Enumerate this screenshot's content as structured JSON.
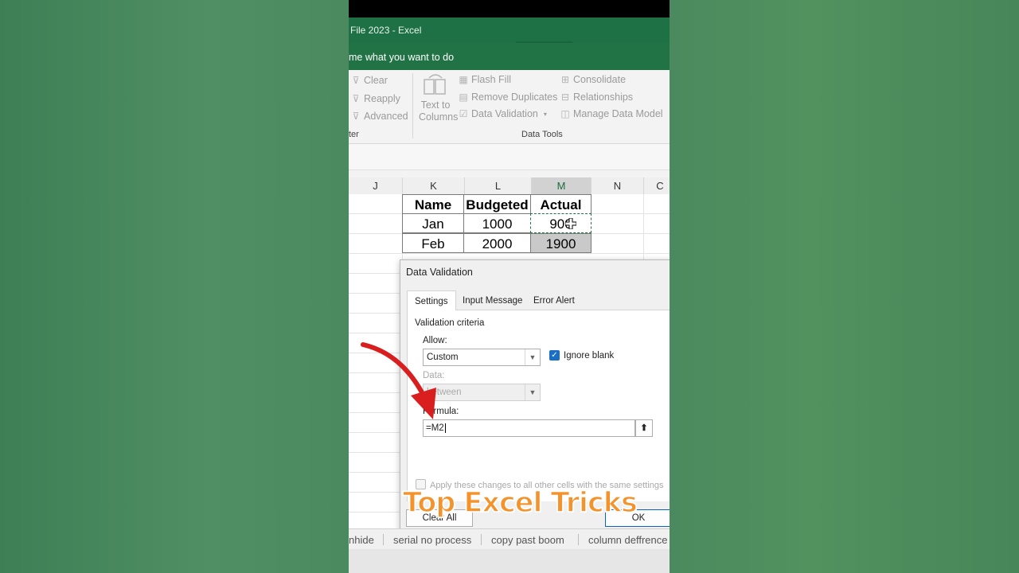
{
  "window": {
    "title": "File 2023  -  Excel",
    "tell_me": "me what you want to do"
  },
  "ribbon": {
    "sort_filter": {
      "clear": "Clear",
      "reapply": "Reapply",
      "advanced": "Advanced",
      "group_label": "ter"
    },
    "data_tools": {
      "text_to_columns_1": "Text to",
      "text_to_columns_2": "Columns",
      "flash_fill": "Flash Fill",
      "remove_duplicates": "Remove Duplicates",
      "data_validation": "Data Validation",
      "consolidate": "Consolidate",
      "relationships": "Relationships",
      "manage_data_model": "Manage Data Model",
      "group_label": "Data Tools"
    }
  },
  "columns": [
    "J",
    "K",
    "L",
    "M",
    "N",
    "C"
  ],
  "table": {
    "headers": [
      "Name",
      "Budgeted",
      "Actual"
    ],
    "rows": [
      [
        "Jan",
        "1000",
        "900"
      ],
      [
        "Feb",
        "2000",
        "1900"
      ]
    ]
  },
  "dialog": {
    "title": "Data Validation",
    "tabs": [
      "Settings",
      "Input Message",
      "Error Alert"
    ],
    "section": "Validation criteria",
    "allow_label": "Allow:",
    "allow_value": "Custom",
    "ignore_blank": "Ignore blank",
    "data_label": "Data:",
    "data_value": "between",
    "formula_label": "Formula:",
    "formula_value": "=M2",
    "apply_all": "Apply these changes to all other cells with the same settings",
    "clear_all": "Clear All",
    "ok": "OK"
  },
  "sheet_tabs": [
    "nhide",
    "serial no process",
    "copy past boom",
    "column deffrence"
  ],
  "overlay": "Top Excel Tricks",
  "colors": {
    "excel_green": "#217346",
    "overlay_orange": "#f4932b",
    "arrow_red": "#d81e1e"
  }
}
